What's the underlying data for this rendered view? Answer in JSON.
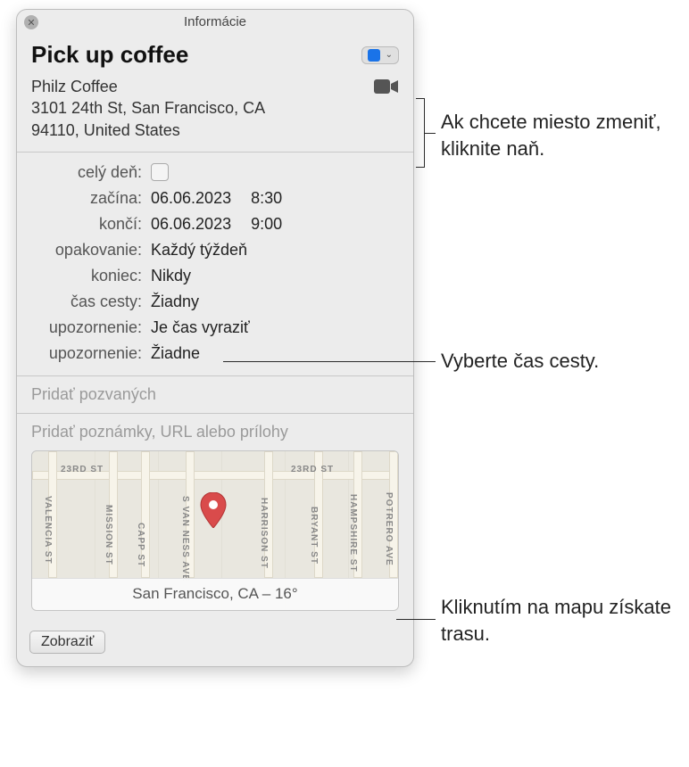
{
  "window": {
    "title": "Informácie"
  },
  "event": {
    "title": "Pick up coffee",
    "location_name": "Philz Coffee",
    "location_addr1": "3101 24th St, San Francisco, CA",
    "location_addr2": "94110, United States",
    "calendar_color": "#1a73e8"
  },
  "labels": {
    "allday": "celý deň:",
    "starts": "začína:",
    "ends": "končí:",
    "repeat": "opakovanie:",
    "end": "koniec:",
    "travel": "čas cesty:",
    "alert1": "upozornenie:",
    "alert2": "upozornenie:"
  },
  "values": {
    "starts_date": "06.06.2023",
    "starts_time": "8:30",
    "ends_date": "06.06.2023",
    "ends_time": "9:00",
    "repeat": "Každý týždeň",
    "end": "Nikdy",
    "travel": "Žiadny",
    "alert1": "Je čas vyraziť",
    "alert2": "Žiadne"
  },
  "placeholders": {
    "invitees": "Pridať pozvaných",
    "notes": "Pridať poznámky, URL alebo prílohy"
  },
  "map": {
    "caption": "San Francisco, CA – 16°",
    "streets": {
      "s23": "23RD ST",
      "valencia": "VALENCIA ST",
      "mission": "MISSION ST",
      "capp": "CAPP ST",
      "vanness": "S VAN NESS AVE",
      "harrison": "HARRISON ST",
      "bryant": "BRYANT ST",
      "hampshire": "HAMPSHIRE ST",
      "potrero": "POTRERO AVE"
    }
  },
  "footer": {
    "show": "Zobraziť"
  },
  "callouts": {
    "location": "Ak chcete miesto zmeniť, kliknite naň.",
    "travel": "Vyberte čas cesty.",
    "map": "Kliknutím na mapu získate trasu."
  }
}
